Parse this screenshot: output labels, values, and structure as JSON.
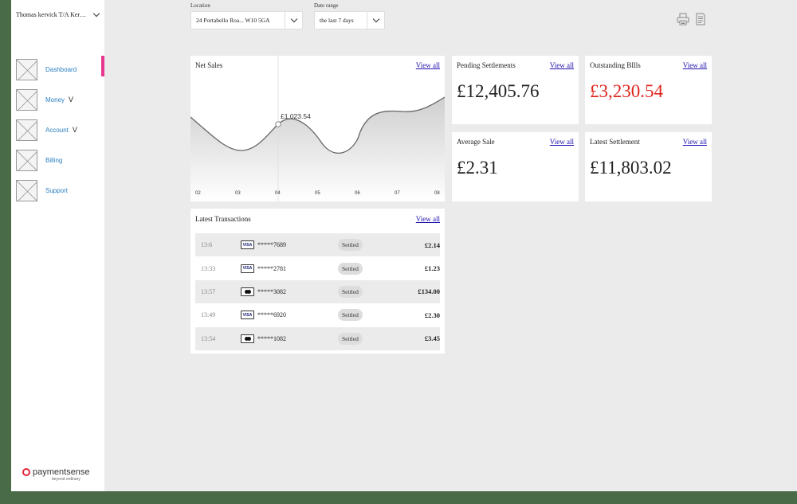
{
  "sidebar": {
    "account_name": "Thomas kervick T/A Kervi...",
    "items": [
      {
        "label": "Dashboard",
        "suffix": ""
      },
      {
        "label": "Money",
        "suffix": "V"
      },
      {
        "label": "Account",
        "suffix": "V"
      },
      {
        "label": "Billing",
        "suffix": ""
      },
      {
        "label": "Support",
        "suffix": ""
      }
    ],
    "brand": {
      "name": "paymentsense",
      "tagline": "beyond ordinary"
    }
  },
  "filters": {
    "location": {
      "label": "Location",
      "value": "24 Portabello Roa... W10 5GA"
    },
    "date_range": {
      "label": "Date range",
      "value": "the last 7 days"
    }
  },
  "toolbar": {
    "print_icon": "print-icon",
    "export_icon": "document-icon"
  },
  "net_sales": {
    "title": "Net Sales",
    "view_all": "View all",
    "highlight_label": "£1,023.54",
    "x_labels": [
      "02",
      "03",
      "04",
      "05",
      "06",
      "07",
      "08"
    ]
  },
  "chart_data": {
    "type": "area",
    "title": "Net Sales",
    "categories": [
      "02",
      "03",
      "04",
      "05",
      "06",
      "07",
      "08"
    ],
    "highlight": {
      "x": "04",
      "label": "£1,023.54"
    }
  },
  "cards": {
    "pending": {
      "title": "Pending Settlements",
      "value": "£12,405.76",
      "view_all": "View all"
    },
    "outstanding": {
      "title": "Outstanding BIlls",
      "value": "£3,230.54",
      "view_all": "View all",
      "color": "#e0261f"
    },
    "average": {
      "title": "Average Sale",
      "value": "£2.31",
      "view_all": "View all"
    },
    "latest": {
      "title": "Latest Settlement",
      "value": "£11,803.02",
      "view_all": "View all"
    }
  },
  "transactions": {
    "title": "Latest Transactions",
    "view_all": "View all",
    "rows": [
      {
        "time": "13:6",
        "card_type": "visa",
        "card_label": "VISA",
        "number": "*****7689",
        "status": "Settled",
        "amount": "£2.14"
      },
      {
        "time": "13:33",
        "card_type": "visa",
        "card_label": "VISA",
        "number": "*****2781",
        "status": "Settled",
        "amount": "£1.23"
      },
      {
        "time": "13:57",
        "card_type": "mastercard",
        "card_label": "",
        "number": "*****3082",
        "status": "Settled",
        "amount": "£134.00"
      },
      {
        "time": "13:49",
        "card_type": "visa",
        "card_label": "VISA",
        "number": "*****6920",
        "status": "Settled",
        "amount": "£2.30"
      },
      {
        "time": "13:54",
        "card_type": "mastercard",
        "card_label": "",
        "number": "*****1082",
        "status": "Settled",
        "amount": "£3.45"
      }
    ]
  }
}
